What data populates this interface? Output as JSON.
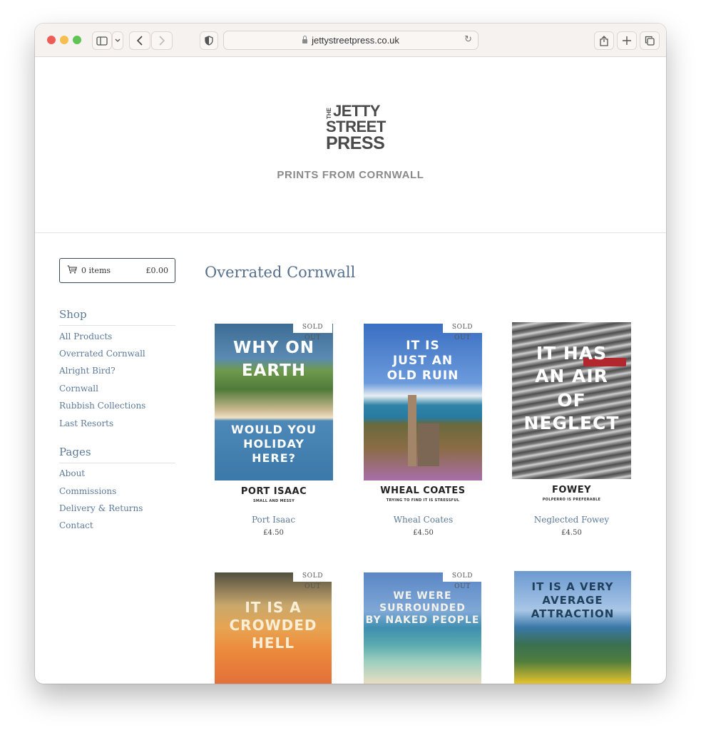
{
  "browser": {
    "url": "jettystreetpress.co.uk",
    "colors": {
      "close": "#ee5d57",
      "minimize": "#f5bf4f",
      "zoom": "#60c454"
    }
  },
  "header": {
    "logo": {
      "the": "THE",
      "line1": "JETTY",
      "line2": "STREET",
      "line3": "PRESS"
    },
    "tagline": "PRINTS FROM CORNWALL"
  },
  "cart": {
    "items": "0 items",
    "total": "£0.00"
  },
  "sidebar": {
    "shop_heading": "Shop",
    "shop_links": [
      "All Products",
      "Overrated Cornwall",
      "Alright Bird?",
      "Cornwall",
      "Rubbish Collections",
      "Last Resorts"
    ],
    "pages_heading": "Pages",
    "pages_links": [
      "About",
      "Commissions",
      "Delivery & Returns",
      "Contact"
    ]
  },
  "main": {
    "title": "Overrated Cornwall",
    "products": [
      {
        "name": "Port Isaac",
        "price": "£4.50",
        "badge": "SOLD OUT",
        "poster_lines": [
          "WHY ON",
          "EARTH",
          "WOULD YOU",
          "HOLIDAY",
          "HERE?"
        ],
        "caption": "PORT ISAAC",
        "subcaption": "SMALL AND MESSY"
      },
      {
        "name": "Wheal Coates",
        "price": "£4.50",
        "badge": "SOLD OUT",
        "poster_lines": [
          "IT IS",
          "JUST AN",
          "OLD RUIN"
        ],
        "caption": "WHEAL COATES",
        "subcaption": "TRYING TO FIND IT IS STRESSFUL"
      },
      {
        "name": "Neglected Fowey",
        "price": "£4.50",
        "badge": "",
        "poster_lines": [
          "IT HAS",
          "AN AIR",
          "OF",
          "NEGLECT"
        ],
        "caption": "FOWEY",
        "subcaption": "POLPERRO IS PREFERABLE"
      },
      {
        "name": "",
        "price": "",
        "badge": "SOLD OUT",
        "poster_lines": [
          "IT IS A",
          "CROWDED",
          "HELL"
        ]
      },
      {
        "name": "",
        "price": "",
        "badge": "SOLD OUT",
        "poster_lines": [
          "WE WERE",
          "SURROUNDED",
          "BY NAKED PEOPLE"
        ]
      },
      {
        "name": "",
        "price": "",
        "badge": "",
        "poster_lines": [
          "IT IS A VERY",
          "AVERAGE",
          "ATTRACTION"
        ]
      }
    ]
  }
}
